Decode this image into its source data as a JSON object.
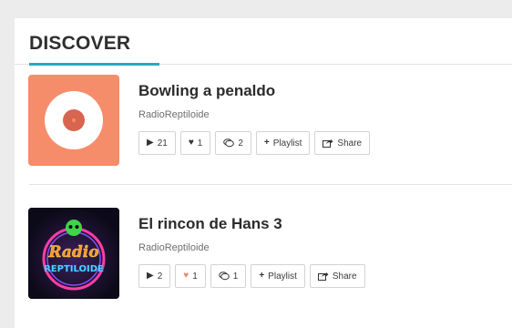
{
  "section": {
    "title": "DISCOVER"
  },
  "tracks": [
    {
      "title": "Bowling a penaldo",
      "artist": "RadioReptiloide",
      "plays": "21",
      "likes": "1",
      "comments": "2",
      "playlist_label": "Playlist",
      "share_label": "Share",
      "art": {
        "type": "vinyl-disc",
        "bg": "#f58c6a"
      },
      "liked": true
    },
    {
      "title": "El rincon de Hans 3",
      "artist": "RadioReptiloide",
      "plays": "2",
      "likes": "1",
      "comments": "1",
      "playlist_label": "Playlist",
      "share_label": "Share",
      "art": {
        "type": "neon-logo",
        "text_top": "Radio",
        "text_bottom": "REPTILOIDE"
      },
      "liked": false
    }
  ],
  "colors": {
    "accent": "#29a8c4",
    "like": "#e8897a"
  }
}
